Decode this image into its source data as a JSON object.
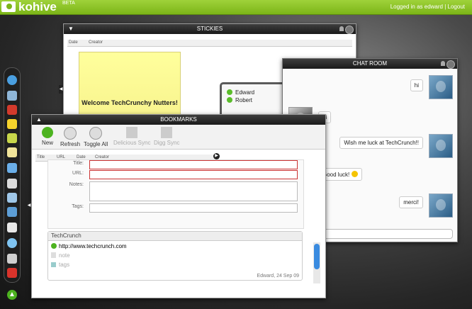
{
  "app": {
    "logo_text": "kohive",
    "beta": "BETA",
    "user_label": "Logged in as edward",
    "logout": "Logout",
    "separator": "|"
  },
  "stickies": {
    "title": "STICKIES",
    "col_date": "Date",
    "col_creator": "Creator",
    "note_text": "Welcome TechCrunchy Nutters!"
  },
  "users": {
    "items": [
      {
        "name": "Edward"
      },
      {
        "name": "Robert"
      }
    ]
  },
  "chat": {
    "title": "CHAT ROOM",
    "messages": [
      {
        "text": "hi",
        "side": "right"
      },
      {
        "text": "hi",
        "side": "left"
      },
      {
        "text": "Wish me luck at TechCrunch!!",
        "side": "right"
      },
      {
        "text": "Good luck!",
        "side": "left"
      },
      {
        "text": "merci!",
        "side": "right"
      }
    ]
  },
  "bookmarks": {
    "title": "BOOKMARKS",
    "toolbar": {
      "new": "New",
      "refresh": "Refresh",
      "toggle_all": "Toggle All",
      "delicious_sync": "Delicious Sync",
      "digg_sync": "Digg Sync"
    },
    "columns": [
      "Title",
      "URL",
      "Date",
      "Creator"
    ],
    "form": {
      "title_label": "Title:",
      "url_label": "URL:",
      "notes_label": "Notes:",
      "tags_label": "Tags:"
    },
    "card": {
      "title": "TechCrunch",
      "url": "http://www.techcrunch.com",
      "note_placeholder": "note",
      "tags_placeholder": "tags",
      "footer": "Edward, 24 Sep 09"
    }
  },
  "colors": {
    "brand_green": "#7cb518",
    "online": "#5bbd2b",
    "scroll_blue": "#3a8be0"
  }
}
